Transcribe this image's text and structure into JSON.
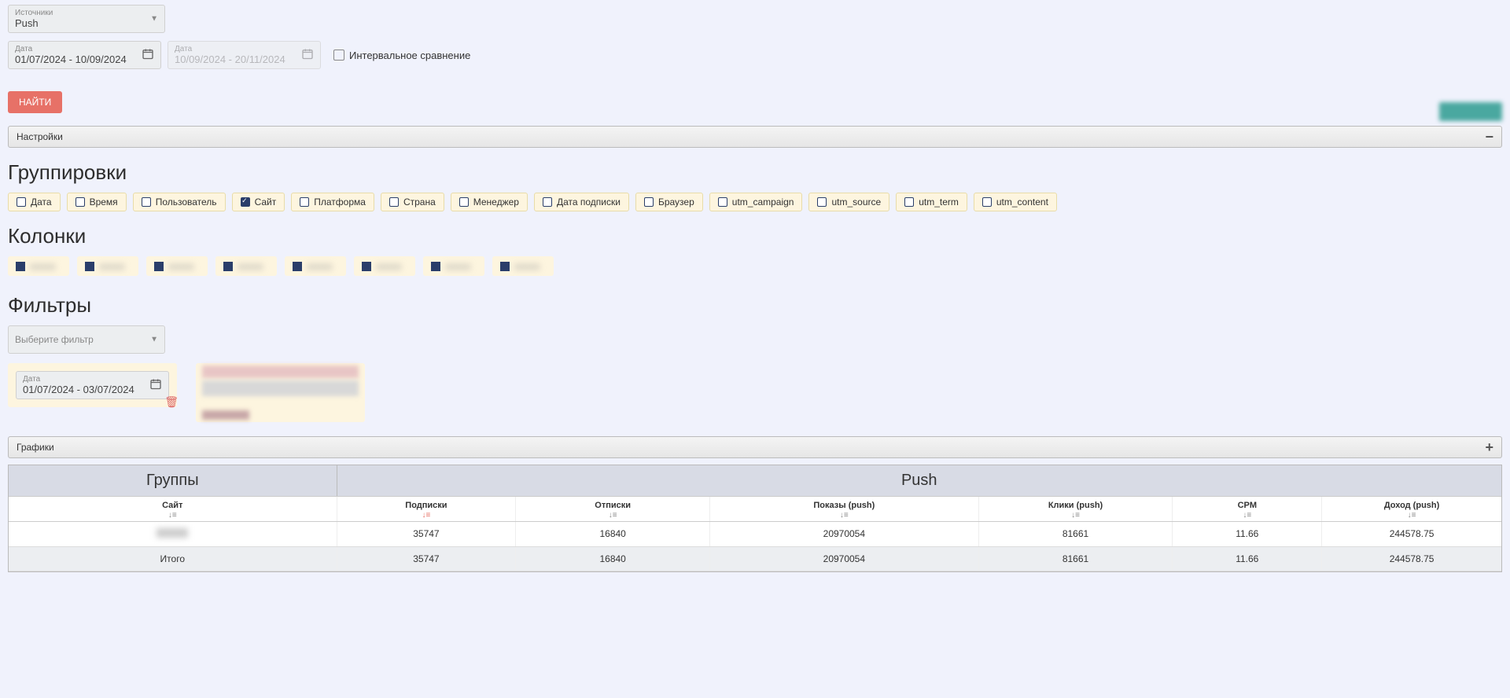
{
  "source_select": {
    "label": "Источники",
    "value": "Push"
  },
  "date1": {
    "label": "Дата",
    "value": "01/07/2024 - 10/09/2024"
  },
  "date2": {
    "label": "Дата",
    "placeholder": "10/09/2024 - 20/11/2024"
  },
  "interval_compare_label": "Интервальное сравнение",
  "search_btn": "НАЙТИ",
  "accordion_settings": "Настройки",
  "groupings_title": "Группировки",
  "groupings": [
    {
      "label": "Дата",
      "checked": false
    },
    {
      "label": "Время",
      "checked": false
    },
    {
      "label": "Пользователь",
      "checked": false
    },
    {
      "label": "Сайт",
      "checked": true
    },
    {
      "label": "Платформа",
      "checked": false
    },
    {
      "label": "Страна",
      "checked": false
    },
    {
      "label": "Менеджер",
      "checked": false
    },
    {
      "label": "Дата подписки",
      "checked": false
    },
    {
      "label": "Браузер",
      "checked": false
    },
    {
      "label": "utm_campaign",
      "checked": false
    },
    {
      "label": "utm_source",
      "checked": false
    },
    {
      "label": "utm_term",
      "checked": false
    },
    {
      "label": "utm_content",
      "checked": false
    }
  ],
  "columns_title": "Колонки",
  "columns_count": 8,
  "filters_title": "Фильтры",
  "filter_select_placeholder": "Выберите фильтр",
  "filter_date": {
    "label": "Дата",
    "value": "01/07/2024 - 03/07/2024"
  },
  "accordion_charts": "Графики",
  "table": {
    "group_header": "Группы",
    "push_header": "Push",
    "columns": [
      "Сайт",
      "Подписки",
      "Отписки",
      "Показы (push)",
      "Клики (push)",
      "CPM",
      "Доход (push)"
    ],
    "sort_active_index": 1,
    "row": {
      "site": "",
      "subs": "35747",
      "unsubs": "16840",
      "impressions": "20970054",
      "clicks": "81661",
      "cpm": "11.66",
      "income": "244578.75"
    },
    "total_label": "Итого",
    "total": {
      "subs": "35747",
      "unsubs": "16840",
      "impressions": "20970054",
      "clicks": "81661",
      "cpm": "11.66",
      "income": "244578.75"
    }
  }
}
